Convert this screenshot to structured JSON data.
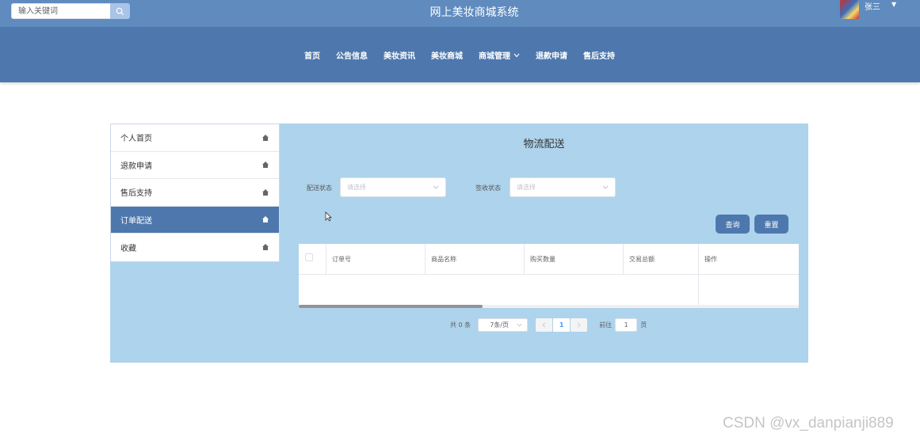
{
  "header": {
    "search_placeholder": "输入关键词",
    "search_icon": "search-icon",
    "title": "网上美妆商城系统",
    "username": "张三",
    "user_menu_icon": "caret-down-icon"
  },
  "nav": {
    "items": [
      {
        "label": "首页"
      },
      {
        "label": "公告信息"
      },
      {
        "label": "美妆资讯"
      },
      {
        "label": "美妆商城"
      },
      {
        "label": "商城管理",
        "icon": "chevron-down-icon"
      },
      {
        "label": "退款申请"
      },
      {
        "label": "售后支持"
      }
    ]
  },
  "sidebar": {
    "items": [
      {
        "label": "个人首页",
        "icon": "home-icon",
        "active": false
      },
      {
        "label": "退款申请",
        "icon": "home-icon",
        "active": false
      },
      {
        "label": "售后支持",
        "icon": "home-icon",
        "active": false
      },
      {
        "label": "订单配送",
        "icon": "home-icon",
        "active": true
      },
      {
        "label": "收藏",
        "icon": "home-icon",
        "active": false
      }
    ]
  },
  "panel": {
    "title": "物流配送",
    "filters": {
      "delivery_status_label": "配送状态",
      "delivery_status_placeholder": "请选择",
      "receipt_status_label": "签收状态",
      "receipt_status_placeholder": "请选择"
    },
    "buttons": {
      "query": "查询",
      "reset": "重置"
    },
    "table": {
      "columns": [
        "订单号",
        "商品名称",
        "购买数量",
        "交易总额",
        "操作"
      ],
      "rows": []
    },
    "pagination": {
      "total_text": "共 0 条",
      "page_size": "7条/页",
      "current_page": "1",
      "goto_prefix": "前往",
      "goto_value": "1",
      "goto_suffix": "页"
    }
  },
  "colors": {
    "topbar": "#5f8bbf",
    "navbar": "#4e78ad",
    "content_bg": "#aed3ec",
    "active": "#4e78ad"
  },
  "watermark": "CSDN @vx_danpianji889"
}
